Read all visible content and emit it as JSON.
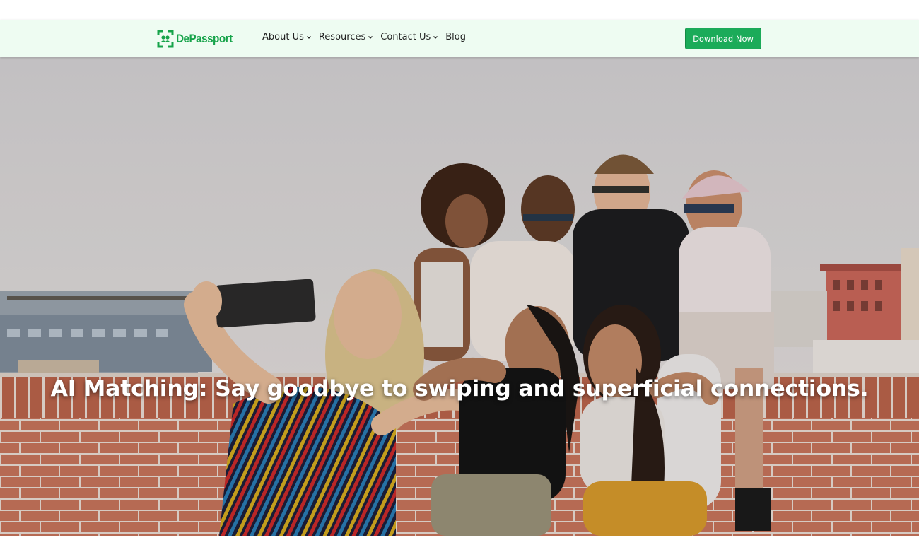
{
  "brand": {
    "name": "DePassport",
    "logo_icon": "passport-frame-icon",
    "accent_color": "#16a34a"
  },
  "nav": {
    "items": [
      {
        "label": "About Us",
        "has_dropdown": true
      },
      {
        "label": "Resources",
        "has_dropdown": true
      },
      {
        "label": "Contact Us",
        "has_dropdown": true
      },
      {
        "label": "Blog",
        "has_dropdown": false
      }
    ],
    "cta_label": "Download Now",
    "cta_color": "#1bab59"
  },
  "hero": {
    "title": "AI Matching: Say goodbye to swiping and superficial connections.",
    "image_description_icon": "group-selfie-photo"
  }
}
